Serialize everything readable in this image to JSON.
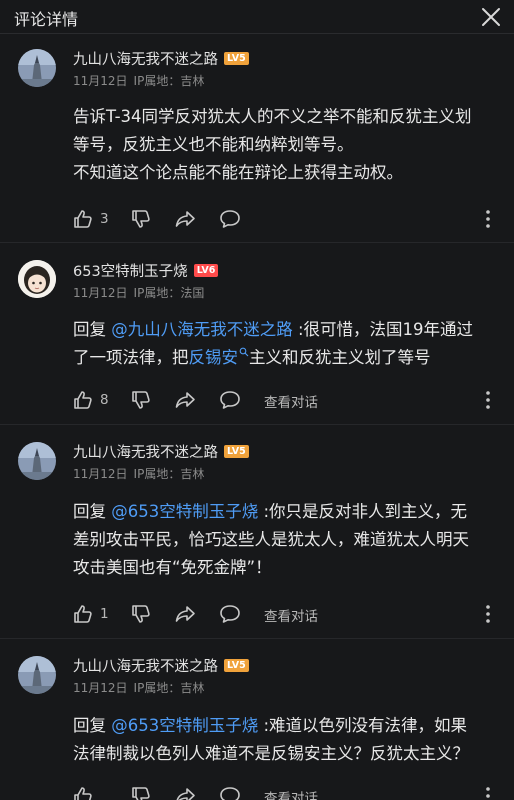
{
  "header": {
    "title": "评论详情"
  },
  "comments": [
    {
      "username": "九山八海无我不迷之路",
      "level": "LV5",
      "level_color": "#f0a23b",
      "date": "11月12日",
      "ip": "IP属地：吉林",
      "lines": [
        "告诉T-34同学反对犹太人的不义之举不能和反犹主义划",
        "等号，反犹主义也不能和纳粹划等号。",
        "不知道这个论点能不能在辩论上获得主动权。"
      ],
      "like_count": "3"
    },
    {
      "username": "653空特制玉子烧",
      "level": "LV6",
      "level_color": "#ff4b4b",
      "date": "11月12日",
      "ip": "IP属地：法国",
      "reply_label": "回复",
      "mention": "@九山八海无我不迷之路",
      "line1_rest": ":很可惜，法国19年通过",
      "line2_pre": "了一项法律，把",
      "keyword": "反锡安",
      "line2_post": "主义和反犹主义划了等号",
      "like_count": "8",
      "view_conversation": "查看对话"
    },
    {
      "username": "九山八海无我不迷之路",
      "level": "LV5",
      "level_color": "#f0a23b",
      "date": "11月12日",
      "ip": "IP属地：吉林",
      "reply_label": "回复",
      "mention": "@653空特制玉子烧",
      "line1_rest": ":你只是反对非人到主义，无",
      "line2": "差别攻击平民，恰巧这些人是犹太人，难道犹太人明天",
      "line3": "攻击美国也有“免死金牌”！",
      "like_count": "1",
      "view_conversation": "查看对话"
    },
    {
      "username": "九山八海无我不迷之路",
      "level": "LV5",
      "level_color": "#f0a23b",
      "date": "11月12日",
      "ip": "IP属地：吉林",
      "reply_label": "回复",
      "mention": "@653空特制玉子烧",
      "line1_rest": ":难道以色列没有法律，如果",
      "line2": "法律制裁以色列人难道不是反锡安主义？反犹太主义？",
      "view_conversation": "查看对话"
    }
  ],
  "icons": {
    "close": "close-icon",
    "like": "thumbs-up-icon",
    "dislike": "thumbs-down-icon",
    "share": "share-icon",
    "comment": "comment-icon",
    "more": "more-vertical-icon",
    "search": "search-icon"
  }
}
